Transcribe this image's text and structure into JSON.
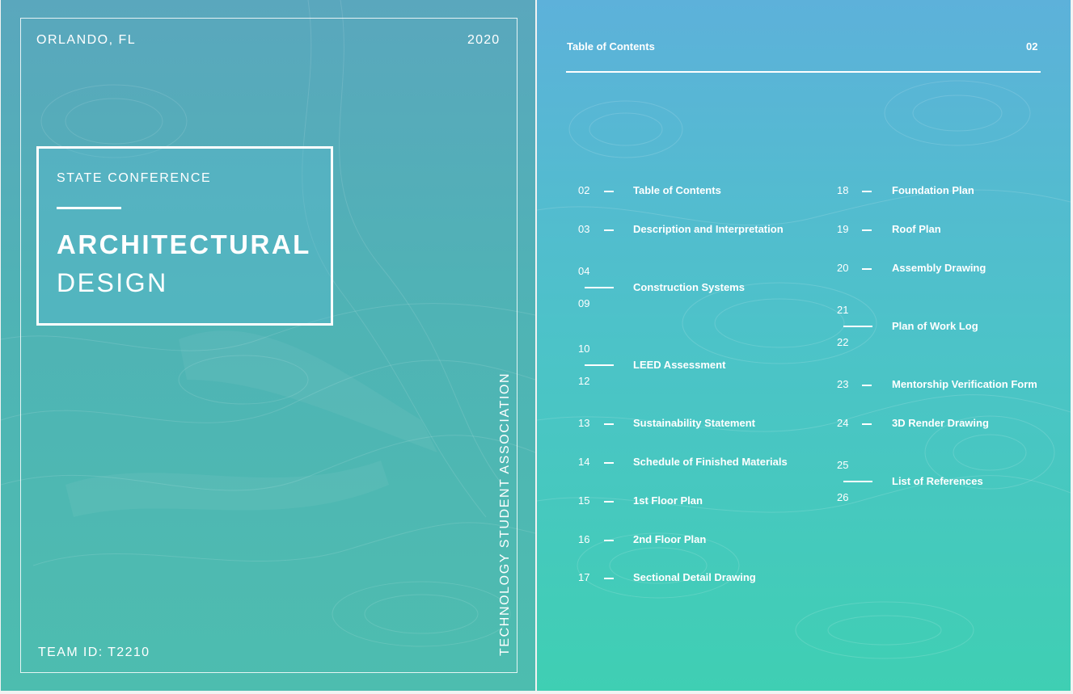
{
  "cover": {
    "location": "ORLANDO, FL",
    "year": "2020",
    "kicker": "STATE CONFERENCE",
    "title_main": "ARCHITECTURAL",
    "title_sub": "DESIGN",
    "organization": "TECHNOLOGY STUDENT ASSOCIATION",
    "team_id": "TEAM ID: T2210"
  },
  "toc": {
    "header": "Table of Contents",
    "page_number": "02",
    "left_column": [
      {
        "pages": [
          "02"
        ],
        "label": "Table of Contents"
      },
      {
        "pages": [
          "03"
        ],
        "label": "Description and Interpretation"
      },
      {
        "pages": [
          "04",
          "09"
        ],
        "label": "Construction Systems"
      },
      {
        "pages": [
          "10",
          "12"
        ],
        "label": "LEED Assessment"
      },
      {
        "pages": [
          "13"
        ],
        "label": "Sustainability Statement"
      },
      {
        "pages": [
          "14"
        ],
        "label": "Schedule of Finished Materials"
      },
      {
        "pages": [
          "15"
        ],
        "label": "1st Floor Plan"
      },
      {
        "pages": [
          "16"
        ],
        "label": "2nd Floor Plan"
      },
      {
        "pages": [
          "17"
        ],
        "label": "Sectional Detail Drawing"
      }
    ],
    "right_column": [
      {
        "pages": [
          "18"
        ],
        "label": "Foundation Plan"
      },
      {
        "pages": [
          "19"
        ],
        "label": "Roof Plan"
      },
      {
        "pages": [
          "20"
        ],
        "label": "Assembly Drawing"
      },
      {
        "pages": [
          "21",
          "22"
        ],
        "label": "Plan of Work Log"
      },
      {
        "pages": [
          "23"
        ],
        "label": "Mentorship Verification Form"
      },
      {
        "pages": [
          "24"
        ],
        "label": "3D Render Drawing"
      },
      {
        "pages": [
          "25",
          "26"
        ],
        "label": "List of References"
      }
    ]
  }
}
